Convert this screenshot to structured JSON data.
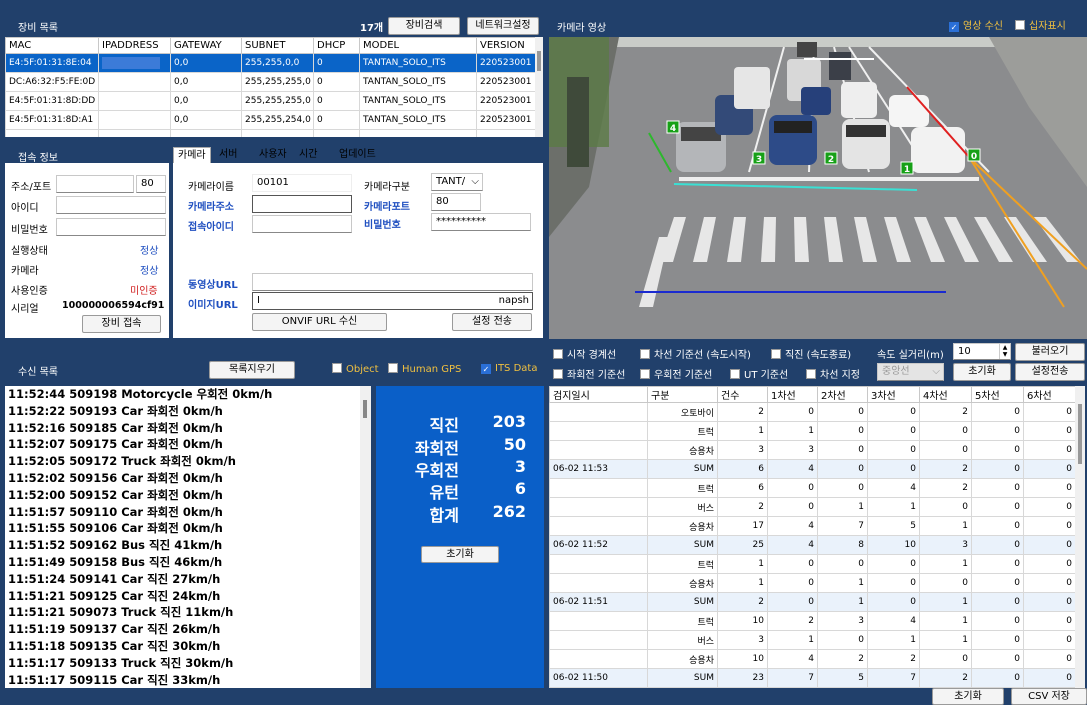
{
  "device_list": {
    "title": "장비 목록",
    "count": "17개",
    "search_btn": "장비검색",
    "network_btn": "네트워크설정",
    "columns": [
      "MAC",
      "IPADDRESS",
      "GATEWAY",
      "SUBNET",
      "DHCP",
      "MODEL",
      "VERSION"
    ],
    "rows": [
      {
        "mac": "E4:5F:01:31:8E:04",
        "ip": "",
        "gw": "0,0",
        "subnet": "255,255,0,0",
        "dhcp": "0",
        "model": "TANTAN_SOLO_ITS",
        "ver": "220523001"
      },
      {
        "mac": "DC:A6:32:F5:FE:0D",
        "ip": "",
        "gw": "0,0",
        "subnet": "255,255,255,0",
        "dhcp": "0",
        "model": "TANTAN_SOLO_ITS",
        "ver": "220523001"
      },
      {
        "mac": "E4:5F:01:31:8D:DD",
        "ip": "",
        "gw": "0,0",
        "subnet": "255,255,255,0",
        "dhcp": "0",
        "model": "TANTAN_SOLO_ITS",
        "ver": "220523001"
      },
      {
        "mac": "E4:5F:01:31:8D:A1",
        "ip": "",
        "gw": "0,0",
        "subnet": "255,255,254,0",
        "dhcp": "0",
        "model": "TANTAN_SOLO_ITS",
        "ver": "220523001"
      }
    ]
  },
  "connection": {
    "title": "접속 정보",
    "addr_label": "주소/포트",
    "port": "80",
    "id_label": "아이디",
    "pw_label": "비밀번호",
    "run_label": "실행상태",
    "run_value": "정상",
    "cam_label": "카메라",
    "cam_value": "정상",
    "auth_label": "사용인증",
    "auth_value": "미인증",
    "serial_label": "시리얼",
    "serial_value": "100000006594cf91",
    "connect_btn": "장비 접속"
  },
  "settings": {
    "tabs": [
      "카메라",
      "서버",
      "사용자",
      "시간",
      "업데이트"
    ],
    "cam_name_label": "카메라이름",
    "cam_name": "00101",
    "cam_type_label": "카메라구분",
    "cam_type": "TANT/",
    "cam_addr_label": "카메라주소",
    "cam_port_label": "카메라포트",
    "cam_port": "80",
    "login_id_label": "접속아이디",
    "pw_label": "비밀번호",
    "pw_value": "**********",
    "video_url_label": "동영상URL",
    "image_url_label": "이미지URL",
    "image_url_value": "I",
    "image_url_tail": "napsh",
    "onvif_btn": "ONVIF URL 수신",
    "save_btn": "설정 전송"
  },
  "camera": {
    "title": "카메라 영상",
    "video_recv": "영상 수신",
    "crosshair": "십자표시",
    "lane_labels": [
      "4",
      "3",
      "2",
      "1",
      "0"
    ]
  },
  "controls": {
    "start_line": "시작 경계선",
    "lane_base": "차선 기준선 (속도시작)",
    "straight": "직진 (속도종료)",
    "speed_label": "속도 실거리(m)",
    "speed_value": "10",
    "load_btn": "불러오기",
    "left_base": "좌회전 기준선",
    "right_base": "우회전 기준선",
    "ut_base": "UT 기준선",
    "lane_set": "차선 지정",
    "lane_select": "중앙선",
    "reset_btn": "초기화",
    "send_btn": "설정전송"
  },
  "recv": {
    "title": "수신 목록",
    "clear_btn": "목록지우기",
    "object": "Object",
    "human_gps": "Human GPS",
    "its_data": "ITS Data",
    "log": [
      "11:52:44 509198 Motorcycle 우회전 0km/h",
      "11:52:22 509193 Car 좌회전 0km/h",
      "11:52:16 509185 Car 좌회전 0km/h",
      "11:52:07 509175 Car 좌회전 0km/h",
      "11:52:05 509172 Truck 좌회전 0km/h",
      "11:52:02 509156 Car 좌회전 0km/h",
      "11:52:00 509152 Car 좌회전 0km/h",
      "11:51:57 509110 Car 좌회전 0km/h",
      "11:51:55 509106 Car 좌회전 0km/h",
      "11:51:52 509162 Bus 직진 41km/h",
      "11:51:49 509158 Bus 직진 46km/h",
      "11:51:24 509141 Car 직진 27km/h",
      "11:51:21 509125 Car 직진 24km/h",
      "11:51:21 509073 Truck 직진 11km/h",
      "11:51:19 509137 Car 직진 26km/h",
      "11:51:18 509135 Car 직진 30km/h",
      "11:51:17 509133 Truck 직진 30km/h",
      "11:51:17 509115 Car 직진 33km/h"
    ]
  },
  "stats": {
    "rows": [
      {
        "k": "직진",
        "v": "203"
      },
      {
        "k": "좌회전",
        "v": "50"
      },
      {
        "k": "우회전",
        "v": "3"
      },
      {
        "k": "유턴",
        "v": "6"
      },
      {
        "k": "합계",
        "v": "262"
      }
    ],
    "reset_btn": "초기화"
  },
  "counts": {
    "columns": [
      "검지일시",
      "구분",
      "건수",
      "1차선",
      "2차선",
      "3차선",
      "4차선",
      "5차선",
      "6차선"
    ],
    "rows": [
      [
        "",
        "오토바이",
        "2",
        "0",
        "0",
        "0",
        "2",
        "0",
        "0"
      ],
      [
        "",
        "트럭",
        "1",
        "1",
        "0",
        "0",
        "0",
        "0",
        "0"
      ],
      [
        "",
        "승용차",
        "3",
        "3",
        "0",
        "0",
        "0",
        "0",
        "0"
      ],
      [
        "06-02 11:53",
        "SUM",
        "6",
        "4",
        "0",
        "0",
        "2",
        "0",
        "0"
      ],
      [
        "",
        "트럭",
        "6",
        "0",
        "0",
        "4",
        "2",
        "0",
        "0"
      ],
      [
        "",
        "버스",
        "2",
        "0",
        "1",
        "1",
        "0",
        "0",
        "0"
      ],
      [
        "",
        "승용차",
        "17",
        "4",
        "7",
        "5",
        "1",
        "0",
        "0"
      ],
      [
        "06-02 11:52",
        "SUM",
        "25",
        "4",
        "8",
        "10",
        "3",
        "0",
        "0"
      ],
      [
        "",
        "트럭",
        "1",
        "0",
        "0",
        "0",
        "1",
        "0",
        "0"
      ],
      [
        "",
        "승용차",
        "1",
        "0",
        "1",
        "0",
        "0",
        "0",
        "0"
      ],
      [
        "06-02 11:51",
        "SUM",
        "2",
        "0",
        "1",
        "0",
        "1",
        "0",
        "0"
      ],
      [
        "",
        "트럭",
        "10",
        "2",
        "3",
        "4",
        "1",
        "0",
        "0"
      ],
      [
        "",
        "버스",
        "3",
        "1",
        "0",
        "1",
        "1",
        "0",
        "0"
      ],
      [
        "",
        "승용차",
        "10",
        "4",
        "2",
        "2",
        "0",
        "0",
        "0"
      ],
      [
        "06-02 11:50",
        "SUM",
        "23",
        "7",
        "5",
        "7",
        "2",
        "0",
        "0"
      ]
    ],
    "reset_btn": "초기화",
    "csv_btn": "CSV 저장"
  }
}
